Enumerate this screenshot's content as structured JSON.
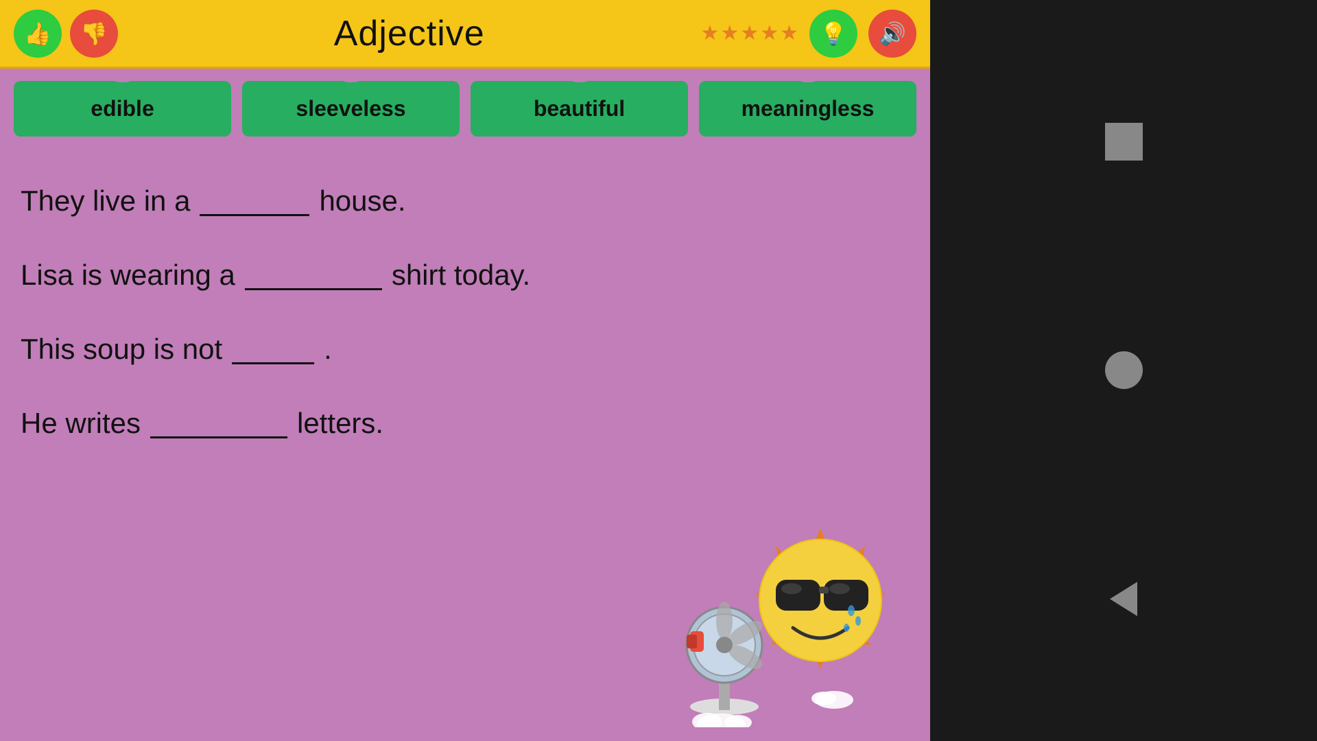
{
  "header": {
    "title": "Adjective",
    "thumbs_up_icon": "👍",
    "thumbs_down_icon": "👎",
    "light_icon": "💡",
    "sound_icon": "🔊",
    "stars": [
      "★",
      "★",
      "★",
      "★",
      "★"
    ]
  },
  "words": [
    {
      "label": "edible",
      "id": "word-edible"
    },
    {
      "label": "sleeveless",
      "id": "word-sleeveless"
    },
    {
      "label": "beautiful",
      "id": "word-beautiful"
    },
    {
      "label": "meaningless",
      "id": "word-meaningless"
    }
  ],
  "sentences": [
    {
      "before": "They live in a",
      "blank_size": "medium",
      "after": "house.",
      "id": "sentence-1"
    },
    {
      "before": "Lisa is wearing a",
      "blank_size": "long",
      "after": "shirt today.",
      "id": "sentence-2"
    },
    {
      "before": "This soup is not",
      "blank_size": "short",
      "after": ".",
      "id": "sentence-3"
    },
    {
      "before": "He writes",
      "blank_size": "long",
      "after": "letters.",
      "id": "sentence-4"
    }
  ],
  "sidebar": {
    "square_label": "square",
    "circle_label": "circle",
    "back_label": "back"
  }
}
